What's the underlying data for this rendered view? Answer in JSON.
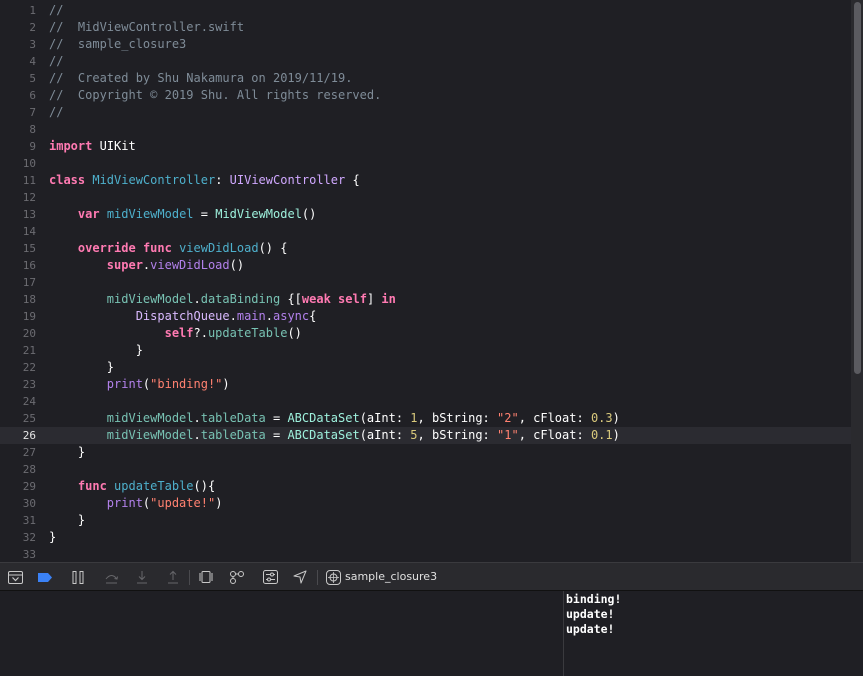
{
  "editor": {
    "current_line": 26,
    "lines": [
      {
        "n": "1",
        "tokens": [
          {
            "t": "//",
            "c": "com"
          }
        ]
      },
      {
        "n": "2",
        "tokens": [
          {
            "t": "//  MidViewController.swift",
            "c": "com"
          }
        ]
      },
      {
        "n": "3",
        "tokens": [
          {
            "t": "//  sample_closure3",
            "c": "com"
          }
        ]
      },
      {
        "n": "4",
        "tokens": [
          {
            "t": "//",
            "c": "com"
          }
        ]
      },
      {
        "n": "5",
        "tokens": [
          {
            "t": "//  Created by Shu Nakamura on 2019/11/19.",
            "c": "com"
          }
        ]
      },
      {
        "n": "6",
        "tokens": [
          {
            "t": "//  Copyright © 2019 Shu. All rights reserved.",
            "c": "com"
          }
        ]
      },
      {
        "n": "7",
        "tokens": [
          {
            "t": "//",
            "c": "com"
          }
        ]
      },
      {
        "n": "8",
        "tokens": []
      },
      {
        "n": "9",
        "tokens": [
          {
            "t": "import",
            "c": "kw"
          },
          {
            "t": " UIKit",
            "c": "plain"
          }
        ]
      },
      {
        "n": "10",
        "tokens": []
      },
      {
        "n": "11",
        "tokens": [
          {
            "t": "class",
            "c": "kw"
          },
          {
            "t": " ",
            "c": "plain"
          },
          {
            "t": "MidViewController",
            "c": "decl"
          },
          {
            "t": ": ",
            "c": "plain"
          },
          {
            "t": "UIViewController",
            "c": "type"
          },
          {
            "t": " {",
            "c": "plain"
          }
        ]
      },
      {
        "n": "12",
        "tokens": []
      },
      {
        "n": "13",
        "tokens": [
          {
            "t": "    ",
            "c": "plain"
          },
          {
            "t": "var",
            "c": "kw"
          },
          {
            "t": " ",
            "c": "plain"
          },
          {
            "t": "midViewModel",
            "c": "decl"
          },
          {
            "t": " = ",
            "c": "plain"
          },
          {
            "t": "MidViewModel",
            "c": "sys"
          },
          {
            "t": "()",
            "c": "plain"
          }
        ]
      },
      {
        "n": "14",
        "tokens": []
      },
      {
        "n": "15",
        "tokens": [
          {
            "t": "    ",
            "c": "plain"
          },
          {
            "t": "override",
            "c": "kw"
          },
          {
            "t": " ",
            "c": "plain"
          },
          {
            "t": "func",
            "c": "kw"
          },
          {
            "t": " ",
            "c": "plain"
          },
          {
            "t": "viewDidLoad",
            "c": "decl"
          },
          {
            "t": "() {",
            "c": "plain"
          }
        ]
      },
      {
        "n": "16",
        "tokens": [
          {
            "t": "        ",
            "c": "plain"
          },
          {
            "t": "super",
            "c": "kw"
          },
          {
            "t": ".",
            "c": "plain"
          },
          {
            "t": "viewDidLoad",
            "c": "fn"
          },
          {
            "t": "()",
            "c": "plain"
          }
        ]
      },
      {
        "n": "17",
        "tokens": []
      },
      {
        "n": "18",
        "tokens": [
          {
            "t": "        ",
            "c": "plain"
          },
          {
            "t": "midViewModel",
            "c": "ref"
          },
          {
            "t": ".",
            "c": "plain"
          },
          {
            "t": "dataBinding",
            "c": "ref"
          },
          {
            "t": " {[",
            "c": "plain"
          },
          {
            "t": "weak",
            "c": "kw"
          },
          {
            "t": " ",
            "c": "plain"
          },
          {
            "t": "self",
            "c": "kw"
          },
          {
            "t": "] ",
            "c": "plain"
          },
          {
            "t": "in",
            "c": "kw"
          }
        ]
      },
      {
        "n": "19",
        "tokens": [
          {
            "t": "            ",
            "c": "plain"
          },
          {
            "t": "DispatchQueue",
            "c": "cls"
          },
          {
            "t": ".",
            "c": "plain"
          },
          {
            "t": "main",
            "c": "fn"
          },
          {
            "t": ".",
            "c": "plain"
          },
          {
            "t": "async",
            "c": "fn"
          },
          {
            "t": "{",
            "c": "plain"
          }
        ]
      },
      {
        "n": "20",
        "tokens": [
          {
            "t": "                ",
            "c": "plain"
          },
          {
            "t": "self",
            "c": "kw"
          },
          {
            "t": "?.",
            "c": "plain"
          },
          {
            "t": "updateTable",
            "c": "ref"
          },
          {
            "t": "()",
            "c": "plain"
          }
        ]
      },
      {
        "n": "21",
        "tokens": [
          {
            "t": "            }",
            "c": "plain"
          }
        ]
      },
      {
        "n": "22",
        "tokens": [
          {
            "t": "        }",
            "c": "plain"
          }
        ]
      },
      {
        "n": "23",
        "tokens": [
          {
            "t": "        ",
            "c": "plain"
          },
          {
            "t": "print",
            "c": "fn"
          },
          {
            "t": "(",
            "c": "plain"
          },
          {
            "t": "\"binding!\"",
            "c": "str"
          },
          {
            "t": ")",
            "c": "plain"
          }
        ]
      },
      {
        "n": "24",
        "tokens": []
      },
      {
        "n": "25",
        "tokens": [
          {
            "t": "        ",
            "c": "plain"
          },
          {
            "t": "midViewModel",
            "c": "ref"
          },
          {
            "t": ".",
            "c": "plain"
          },
          {
            "t": "tableData",
            "c": "ref"
          },
          {
            "t": " = ",
            "c": "plain"
          },
          {
            "t": "ABCDataSet",
            "c": "sys"
          },
          {
            "t": "(aInt: ",
            "c": "plain"
          },
          {
            "t": "1",
            "c": "num"
          },
          {
            "t": ", bString: ",
            "c": "plain"
          },
          {
            "t": "\"2\"",
            "c": "str"
          },
          {
            "t": ", cFloat: ",
            "c": "plain"
          },
          {
            "t": "0.3",
            "c": "num"
          },
          {
            "t": ")",
            "c": "plain"
          }
        ]
      },
      {
        "n": "26",
        "tokens": [
          {
            "t": "        ",
            "c": "plain"
          },
          {
            "t": "midViewModel",
            "c": "ref"
          },
          {
            "t": ".",
            "c": "plain"
          },
          {
            "t": "tableData",
            "c": "ref"
          },
          {
            "t": " = ",
            "c": "plain"
          },
          {
            "t": "ABCDataSet",
            "c": "sys"
          },
          {
            "t": "(aInt: ",
            "c": "plain"
          },
          {
            "t": "5",
            "c": "num"
          },
          {
            "t": ", bString: ",
            "c": "plain"
          },
          {
            "t": "\"1\"",
            "c": "str"
          },
          {
            "t": ", cFloat: ",
            "c": "plain"
          },
          {
            "t": "0.1",
            "c": "num"
          },
          {
            "t": ")",
            "c": "plain"
          }
        ]
      },
      {
        "n": "27",
        "tokens": [
          {
            "t": "    }",
            "c": "plain"
          }
        ]
      },
      {
        "n": "28",
        "tokens": []
      },
      {
        "n": "29",
        "tokens": [
          {
            "t": "    ",
            "c": "plain"
          },
          {
            "t": "func",
            "c": "kw"
          },
          {
            "t": " ",
            "c": "plain"
          },
          {
            "t": "updateTable",
            "c": "decl"
          },
          {
            "t": "(){",
            "c": "plain"
          }
        ]
      },
      {
        "n": "30",
        "tokens": [
          {
            "t": "        ",
            "c": "plain"
          },
          {
            "t": "print",
            "c": "fn"
          },
          {
            "t": "(",
            "c": "plain"
          },
          {
            "t": "\"update!\"",
            "c": "str"
          },
          {
            "t": ")",
            "c": "plain"
          }
        ]
      },
      {
        "n": "31",
        "tokens": [
          {
            "t": "    }",
            "c": "plain"
          }
        ]
      },
      {
        "n": "32",
        "tokens": [
          {
            "t": "}",
            "c": "plain"
          }
        ]
      },
      {
        "n": "33",
        "tokens": []
      }
    ]
  },
  "debug_toolbar": {
    "target": "sample_closure3",
    "buttons": [
      {
        "name": "hide-debug-area",
        "icon": "hide-debug-area-icon",
        "enabled": true
      },
      {
        "name": "breakpoints-toggle",
        "icon": "breakpoint-icon",
        "enabled": true
      },
      {
        "name": "pause-continue",
        "icon": "pause-icon",
        "enabled": true
      },
      {
        "name": "step-over",
        "icon": "step-over-icon",
        "enabled": false
      },
      {
        "name": "step-into",
        "icon": "step-into-icon",
        "enabled": false
      },
      {
        "name": "step-out",
        "icon": "step-out-icon",
        "enabled": false
      },
      {
        "name": "view-debugger",
        "icon": "view-hierarchy-icon",
        "enabled": true
      },
      {
        "name": "memory-graph",
        "icon": "memory-graph-icon",
        "enabled": true
      },
      {
        "name": "environment-overrides",
        "icon": "environment-overrides-icon",
        "enabled": true
      },
      {
        "name": "simulate-location",
        "icon": "location-arrow-icon",
        "enabled": true
      }
    ]
  },
  "colors": {
    "breakpoint_active": "#3b82f6"
  },
  "console": {
    "lines": [
      "binding!",
      "update!",
      "update!"
    ]
  }
}
